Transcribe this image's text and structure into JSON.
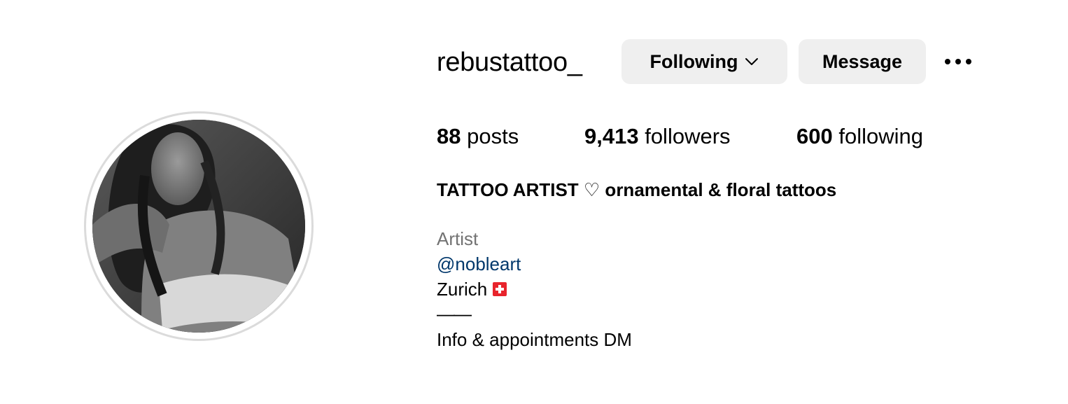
{
  "profile": {
    "username": "rebustattoo_",
    "following_button": "Following",
    "message_button": "Message",
    "more_icon": "more-horizontal-icon",
    "chevron_icon": "chevron-down-icon"
  },
  "stats": {
    "posts_count": "88",
    "posts_label": "posts",
    "followers_count": "9,413",
    "followers_label": "followers",
    "following_count": "600",
    "following_label": "following"
  },
  "bio": {
    "name": "TATTOO ARTIST ♡ ornamental & floral tattoos",
    "category": "Artist",
    "mention": "@nobleart",
    "location": "Zurich",
    "location_flag": "swiss-flag-icon",
    "divider": "——",
    "info": "Info & appointments DM"
  },
  "colors": {
    "button_bg": "#efefef",
    "category_text": "#737373",
    "mention_link": "#00376b",
    "avatar_ring": "#dbdbdb"
  }
}
